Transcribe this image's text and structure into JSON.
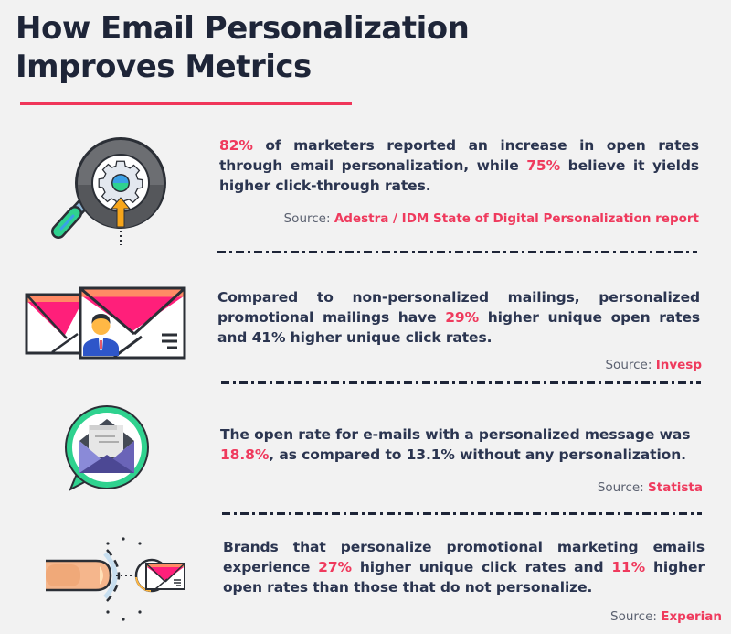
{
  "header": {
    "title_line1": "How Email Personalization",
    "title_line2": "Improves Metrics"
  },
  "colors": {
    "accent": "#ef3a5d",
    "text": "#2b3550",
    "background": "#f2f2f2"
  },
  "stats": [
    {
      "icon": "magnifier-gear-icon",
      "parts": [
        {
          "text": "82%",
          "highlight": true
        },
        {
          "text": " of marketers reported an increase in open rates through email personalization, while ",
          "highlight": false
        },
        {
          "text": "75%",
          "highlight": true
        },
        {
          "text": " believe it yields higher click-through rates.",
          "highlight": false
        }
      ],
      "source_label": "Source:",
      "source_org": "Adestra / IDM State of Digital Personalization report"
    },
    {
      "icon": "personalized-envelopes-icon",
      "parts": [
        {
          "text": "Compared to non-personalized mailings, personalized promotional mailings have ",
          "highlight": false
        },
        {
          "text": "29%",
          "highlight": true
        },
        {
          "text": " higher unique open rates and 41% higher unique click rates.",
          "highlight": false
        }
      ],
      "source_label": "Source:",
      "source_org": "Invesp"
    },
    {
      "icon": "open-envelope-chat-bubble-icon",
      "parts": [
        {
          "text": "The open rate for e-mails with a personalized message was ",
          "highlight": false
        },
        {
          "text": "18.8%",
          "highlight": true
        },
        {
          "text": ", as compared to 13.1% without any personalization.",
          "highlight": false
        }
      ],
      "source_label": "Source:",
      "source_org": "Statista"
    },
    {
      "icon": "finger-tap-email-icon",
      "parts": [
        {
          "text": "Brands that personalize promotional marketing emails experience ",
          "highlight": false
        },
        {
          "text": "27%",
          "highlight": true
        },
        {
          "text": " higher unique click rates and ",
          "highlight": false
        },
        {
          "text": "11%",
          "highlight": true
        },
        {
          "text": " higher open rates than those that do not personalize.",
          "highlight": false
        }
      ],
      "source_label": "Source:",
      "source_org": "Experian"
    }
  ]
}
